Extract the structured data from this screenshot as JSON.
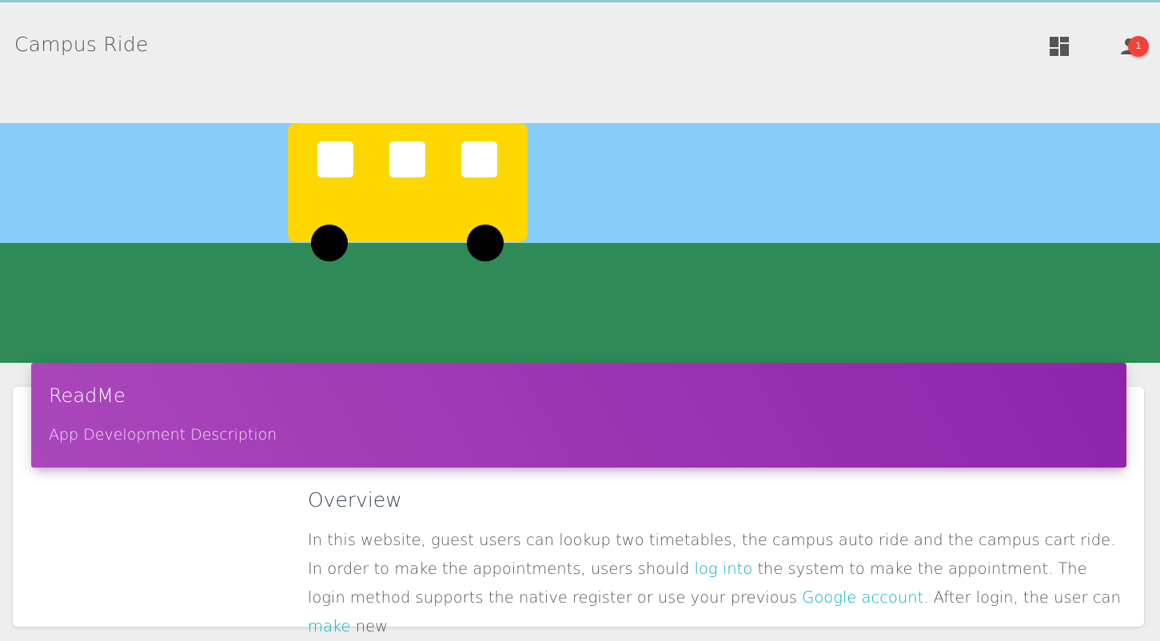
{
  "navbar": {
    "brand": "Campus Ride",
    "dashboard_icon": "dashboard-icon",
    "user_icon": "person-icon",
    "notification_count": "1"
  },
  "banner": {
    "sky_color": "#87cdf9",
    "grass_color": "#2e8b57",
    "bus_color": "#ffd700"
  },
  "card": {
    "title": "ReadMe",
    "subtitle": "App Development Description",
    "header_colors": [
      "#ab47bc",
      "#8e24aa"
    ]
  },
  "content": {
    "heading": "Overview",
    "para": {
      "t1": "In this website, guest users can lookup two timetables, the campus auto ride and the campus cart ride. In order to make the appointments, users should ",
      "link_login": "log into",
      "t2": " the system to make the appointment. The login method supports the native register or use your previous ",
      "link_google": "Google account",
      "t3": ". After login, the user can ",
      "link_make": "make",
      "t4": " new"
    },
    "link_color": "#00acc1"
  }
}
